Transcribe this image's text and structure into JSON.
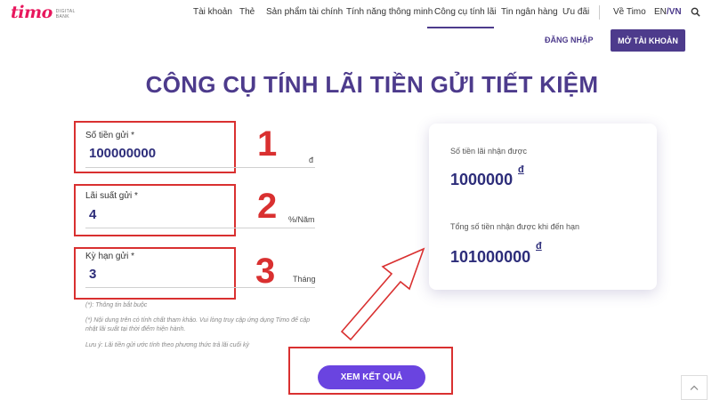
{
  "header": {
    "logo_main": "timo",
    "logo_sub_1": "DIGITAL",
    "logo_sub_2": "BANK",
    "nav": [
      {
        "label": "Tài khoản"
      },
      {
        "label": "Thẻ"
      },
      {
        "label": "Sản phẩm tài chính"
      },
      {
        "label": "Tính năng thông minh"
      },
      {
        "label": "Công cụ tính lãi"
      },
      {
        "label": "Tin ngân hàng"
      },
      {
        "label": "Ưu đãi"
      },
      {
        "label": "Về Timo"
      }
    ],
    "lang_en": "EN",
    "lang_sep": "/",
    "lang_vn": "VN",
    "login_label": "ĐĂNG NHẬP",
    "open_account_label": "MỞ TÀI KHOẢN",
    "accent_color": "#4d3b8c"
  },
  "page_title": "CÔNG CỤ TÍNH LÃI TIỀN GỬI TIẾT KIỆM",
  "form": {
    "deposit": {
      "label": "Số tiền gửi *",
      "value": "100000000",
      "unit": "đ",
      "marker": "1"
    },
    "rate": {
      "label": "Lãi suất gửi *",
      "value": "4",
      "unit": "%/Năm",
      "marker": "2"
    },
    "term": {
      "label": "Kỳ hạn gửi *",
      "value": "3",
      "unit": "Tháng",
      "marker": "3"
    },
    "notes": [
      "(*): Thông tin bắt buộc",
      "(*) Nội dung trên có tính chất tham khảo. Vui lòng truy cập ứng dụng Timo để cập nhật lãi suất tại thời điểm hiện hành.",
      "Lưu ý: Lãi tiền gửi ước tính theo phương thức trả lãi cuối kỳ"
    ],
    "submit_label": "XEM KẾT QUẢ",
    "button_color": "#6a44e0"
  },
  "result": {
    "interest_label": "Số tiền lãi nhận được",
    "interest_value": "1000000",
    "total_label": "Tổng số tiền nhận được khi đến hạn",
    "total_value": "101000000",
    "currency": "đ"
  },
  "highlight_color": "#d93030"
}
